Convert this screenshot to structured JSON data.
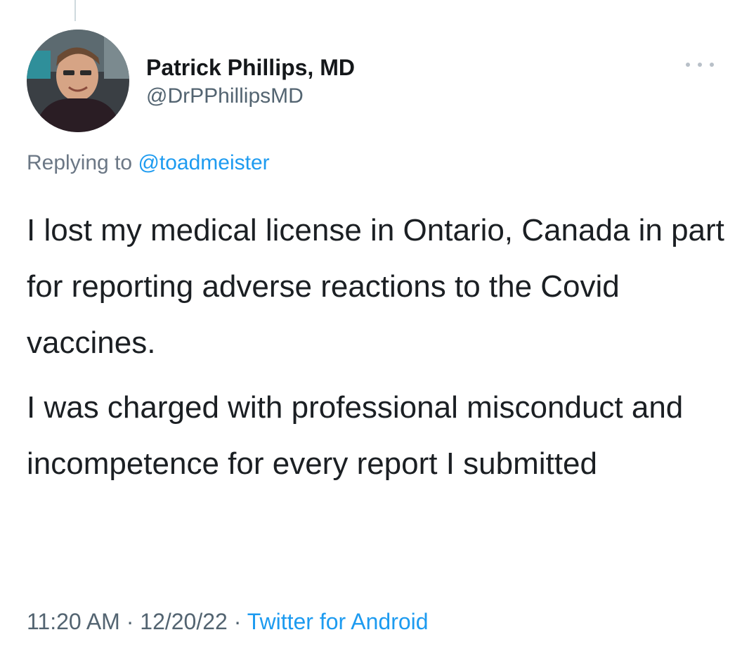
{
  "author": {
    "display_name": "Patrick Phillips, MD",
    "handle": "@DrPPhillipsMD",
    "avatar_icon": "profile-photo"
  },
  "reply": {
    "prefix": "Replying to",
    "mention": "@toadmeister"
  },
  "tweet": {
    "paragraphs": [
      "I lost my medical license in Ontario, Canada in part for reporting adverse reactions to the Covid vaccines.",
      "I was charged with professional misconduct and incompetence for every report I submitted"
    ]
  },
  "meta": {
    "time": "11:20 AM",
    "date": "12/20/22",
    "separator": "·",
    "source": "Twitter for Android"
  },
  "menu": {
    "icon": "more-options-icon"
  },
  "colors": {
    "link": "#1d9bf0",
    "secondary_text": "#536471",
    "primary_text": "#14171a"
  }
}
